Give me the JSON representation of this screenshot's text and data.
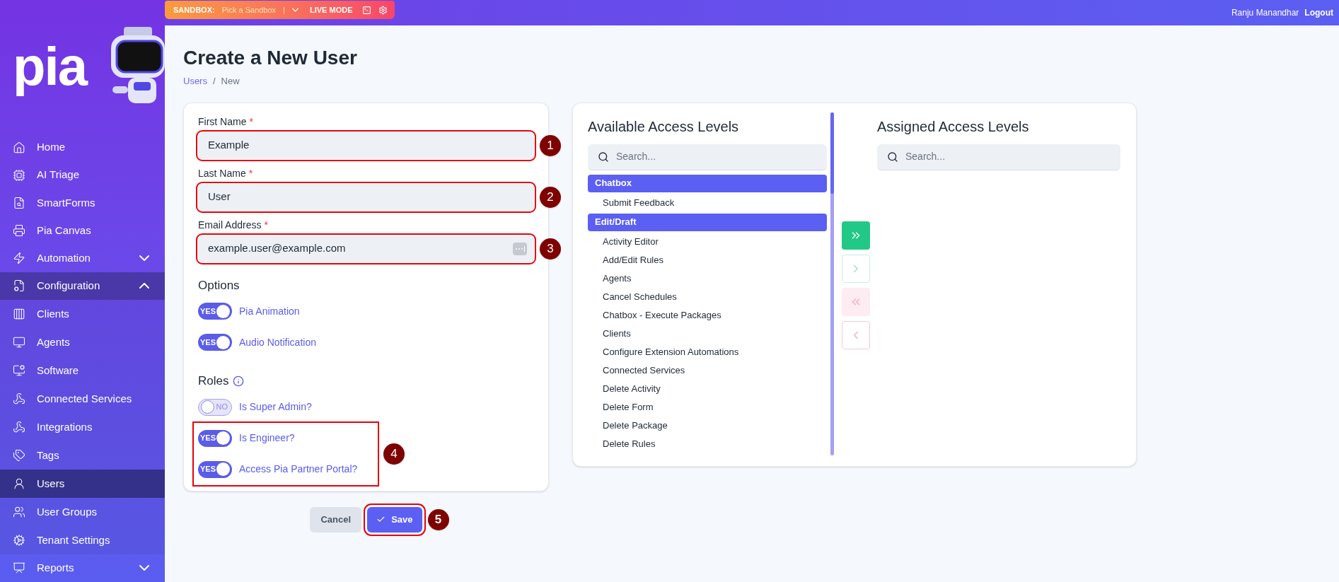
{
  "topbar": {
    "sandbox_label": "SANDBOX:",
    "sandbox_placeholder": "Pick a Sandbox",
    "separator": "|",
    "mode": "LIVE MODE",
    "user": "Ranju Manandhar",
    "logout": "Logout"
  },
  "sidebar": {
    "logo": "pia",
    "items": [
      {
        "label": "Home",
        "selected": false
      },
      {
        "label": "AI Triage",
        "selected": false
      },
      {
        "label": "SmartForms",
        "selected": false
      },
      {
        "label": "Pia Canvas",
        "selected": false
      },
      {
        "label": "Automation",
        "selected": false,
        "expanded": false
      },
      {
        "label": "Configuration",
        "selected": false,
        "expanded": true,
        "children": [
          {
            "label": "Clients",
            "selected": false
          },
          {
            "label": "Agents",
            "selected": false
          },
          {
            "label": "Software",
            "selected": false
          },
          {
            "label": "Connected Services",
            "selected": false
          },
          {
            "label": "Integrations",
            "selected": false
          },
          {
            "label": "Tags",
            "selected": false
          },
          {
            "label": "Users",
            "selected": true
          },
          {
            "label": "User Groups",
            "selected": false
          },
          {
            "label": "Tenant Settings",
            "selected": false
          }
        ]
      },
      {
        "label": "Reports",
        "selected": false,
        "expanded": false
      }
    ]
  },
  "page": {
    "title": "Create a New User",
    "breadcrumb": [
      {
        "label": "Users",
        "kind": "link"
      },
      {
        "label": "New",
        "kind": "current"
      }
    ],
    "breadcrumb_separator": "/"
  },
  "form": {
    "required_mark": "*",
    "fields": [
      {
        "label": "First Name",
        "value": "Example",
        "callout": "1"
      },
      {
        "label": "Last Name",
        "value": "User",
        "callout": "2"
      },
      {
        "label": "Email Address",
        "value": "example.user@example.com",
        "callout": "3",
        "autofill": true
      }
    ],
    "options": {
      "title": "Options",
      "toggles": [
        {
          "label": "Pia Animation",
          "on": true,
          "text": "YES"
        },
        {
          "label": "Audio Notification",
          "on": true,
          "text": "YES"
        }
      ]
    },
    "roles": {
      "title": "Roles",
      "toggles": [
        {
          "label": "Is Super Admin?",
          "on": false,
          "text": "NO"
        },
        {
          "label": "Is Engineer?",
          "on": true,
          "text": "YES"
        },
        {
          "label": "Access Pia Partner Portal?",
          "on": true,
          "text": "YES"
        }
      ],
      "callout": "4"
    },
    "buttons": {
      "cancel": "Cancel",
      "save": "Save",
      "save_callout": "5"
    }
  },
  "access_levels": {
    "available": {
      "title": "Available Access Levels",
      "placeholder": "Search...",
      "items": [
        {
          "label": "Chatbox",
          "kind": "group"
        },
        {
          "label": "Submit Feedback",
          "kind": "item"
        },
        {
          "label": "Edit/Draft",
          "kind": "group"
        },
        {
          "label": "Activity Editor",
          "kind": "item"
        },
        {
          "label": "Add/Edit Rules",
          "kind": "item"
        },
        {
          "label": "Agents",
          "kind": "item"
        },
        {
          "label": "Cancel Schedules",
          "kind": "item"
        },
        {
          "label": "Chatbox - Execute Packages",
          "kind": "item"
        },
        {
          "label": "Clients",
          "kind": "item"
        },
        {
          "label": "Configure Extension Automations",
          "kind": "item"
        },
        {
          "label": "Connected Services",
          "kind": "item"
        },
        {
          "label": "Delete Activity",
          "kind": "item"
        },
        {
          "label": "Delete Form",
          "kind": "item"
        },
        {
          "label": "Delete Package",
          "kind": "item"
        },
        {
          "label": "Delete Rules",
          "kind": "item"
        }
      ]
    },
    "transfer_buttons": [
      {
        "kind": "add-all",
        "disabled": false
      },
      {
        "kind": "add",
        "disabled": true
      },
      {
        "kind": "remove-all",
        "disabled": true
      },
      {
        "kind": "remove",
        "disabled": true
      }
    ],
    "assigned": {
      "title": "Assigned Access Levels",
      "placeholder": "Search..."
    }
  }
}
